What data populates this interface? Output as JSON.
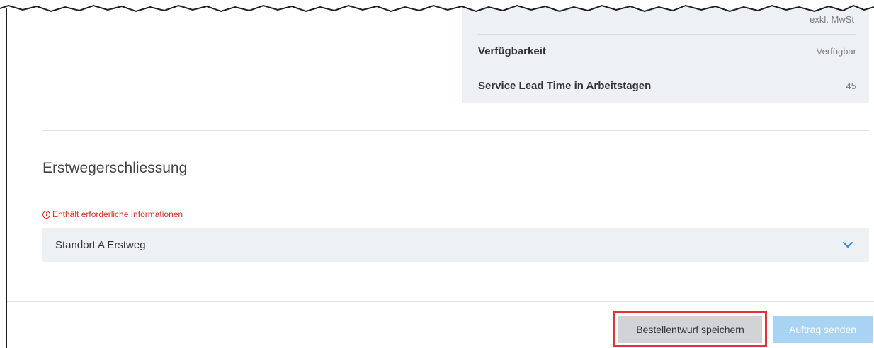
{
  "info_panel": {
    "tax_note": "exkl. MwSt",
    "rows": [
      {
        "label": "Verfügbarkeit",
        "value": "Verfügbar"
      },
      {
        "label": "Service Lead Time in Arbeitstagen",
        "value": "45"
      }
    ]
  },
  "section": {
    "heading": "Erstwegerschliessung",
    "required_note": "Enthält erforderliche Informationen",
    "accordion_label": "Standort A Erstweg"
  },
  "actions": {
    "save_draft_label": "Bestellentwurf speichern",
    "submit_label": "Auftrag senden"
  },
  "colors": {
    "panel_bg": "#edf1f4",
    "required_red": "#d93025",
    "chevron_blue": "#2f86d6",
    "submit_disabled_blue": "#a9d3f2",
    "draft_button_gray": "#d1d3d6",
    "highlight_red": "#e5323a"
  },
  "icons": {
    "required_icon": "info-circle-icon",
    "accordion_icon": "chevron-down-icon"
  }
}
